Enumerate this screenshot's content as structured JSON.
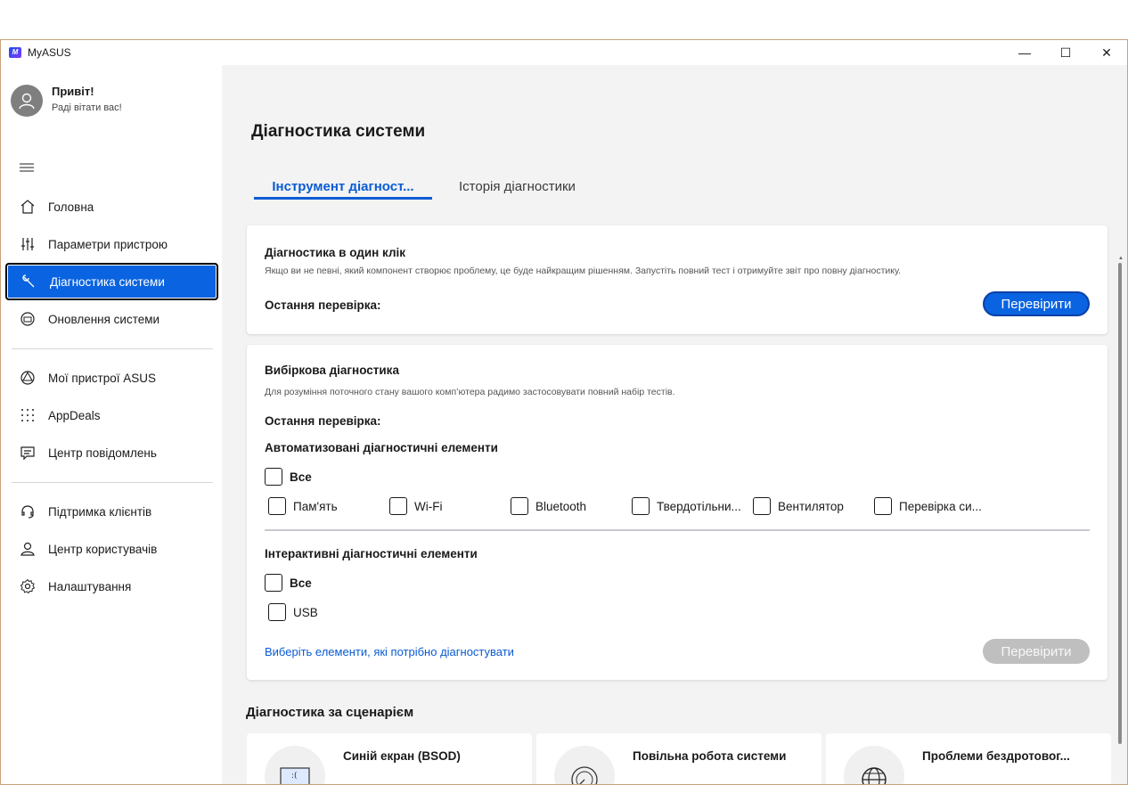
{
  "window": {
    "title": "MyASUS",
    "logo_text": "M",
    "controls": {
      "minimize": "—",
      "maximize": "☐",
      "close": "✕"
    }
  },
  "sidebar": {
    "greeting": "Привіт!",
    "greeting_sub": "Раді вітати вас!",
    "items": [
      {
        "label": "Головна",
        "icon": "home-icon"
      },
      {
        "label": "Параметри пристрою",
        "icon": "sliders-icon"
      },
      {
        "label": "Діагностика системи",
        "icon": "wrench-icon",
        "active": true
      },
      {
        "label": "Оновлення системи",
        "icon": "update-icon"
      },
      {
        "label": "Мої пристрої ASUS",
        "icon": "devices-icon"
      },
      {
        "label": "AppDeals",
        "icon": "grid-dots-icon"
      },
      {
        "label": "Центр повідомлень",
        "icon": "message-icon"
      },
      {
        "label": "Підтримка клієнтів",
        "icon": "headset-icon"
      },
      {
        "label": "Центр користувачів",
        "icon": "user-icon"
      },
      {
        "label": "Налаштування",
        "icon": "gear-icon"
      }
    ]
  },
  "main": {
    "title": "Діагностика системи",
    "tabs": [
      {
        "label": "Інструмент діагност...",
        "active": true
      },
      {
        "label": "Історія діагностики",
        "active": false
      }
    ],
    "one_click": {
      "title": "Діагностика в один клік",
      "description": "Якщо ви не певні, який компонент створює проблему, це буде найкращим рішенням. Запустіть повний тест і отримуйте звіт про повну діагностику.",
      "last_check_label": "Остання перевірка:",
      "button": "Перевірити"
    },
    "selective": {
      "title": "Вибіркова діагностика",
      "description": "Для розуміння поточного стану вашого комп’ютера радимо застосовувати повний набір тестів.",
      "last_check_label": "Остання перевірка:",
      "auto_title": "Автоматизовані діагностичні елементи",
      "all_label": "Все",
      "auto_items": [
        "Пам'ять",
        "Wi-Fi",
        "Bluetooth",
        "Твердотільни...",
        "Вентилятор",
        "Перевірка си..."
      ],
      "interactive_title": "Інтерактивні діагностичні елементи",
      "interactive_all_label": "Все",
      "interactive_items": [
        "USB"
      ],
      "select_link": "Виберіть елементи, які потрібно діагностувати",
      "button": "Перевірити"
    },
    "scenario": {
      "title": "Діагностика за сценарієм",
      "cards": [
        {
          "title": "Синій екран (BSOD)",
          "icon": "bsod-icon"
        },
        {
          "title": "Повільна робота системи",
          "icon": "speedometer-icon"
        },
        {
          "title": "Проблеми бездротовог...",
          "icon": "globe-icon"
        }
      ]
    }
  },
  "colors": {
    "accent": "#0a63e0",
    "link": "#0a5bd3",
    "disabled": "#bfbfbf"
  }
}
